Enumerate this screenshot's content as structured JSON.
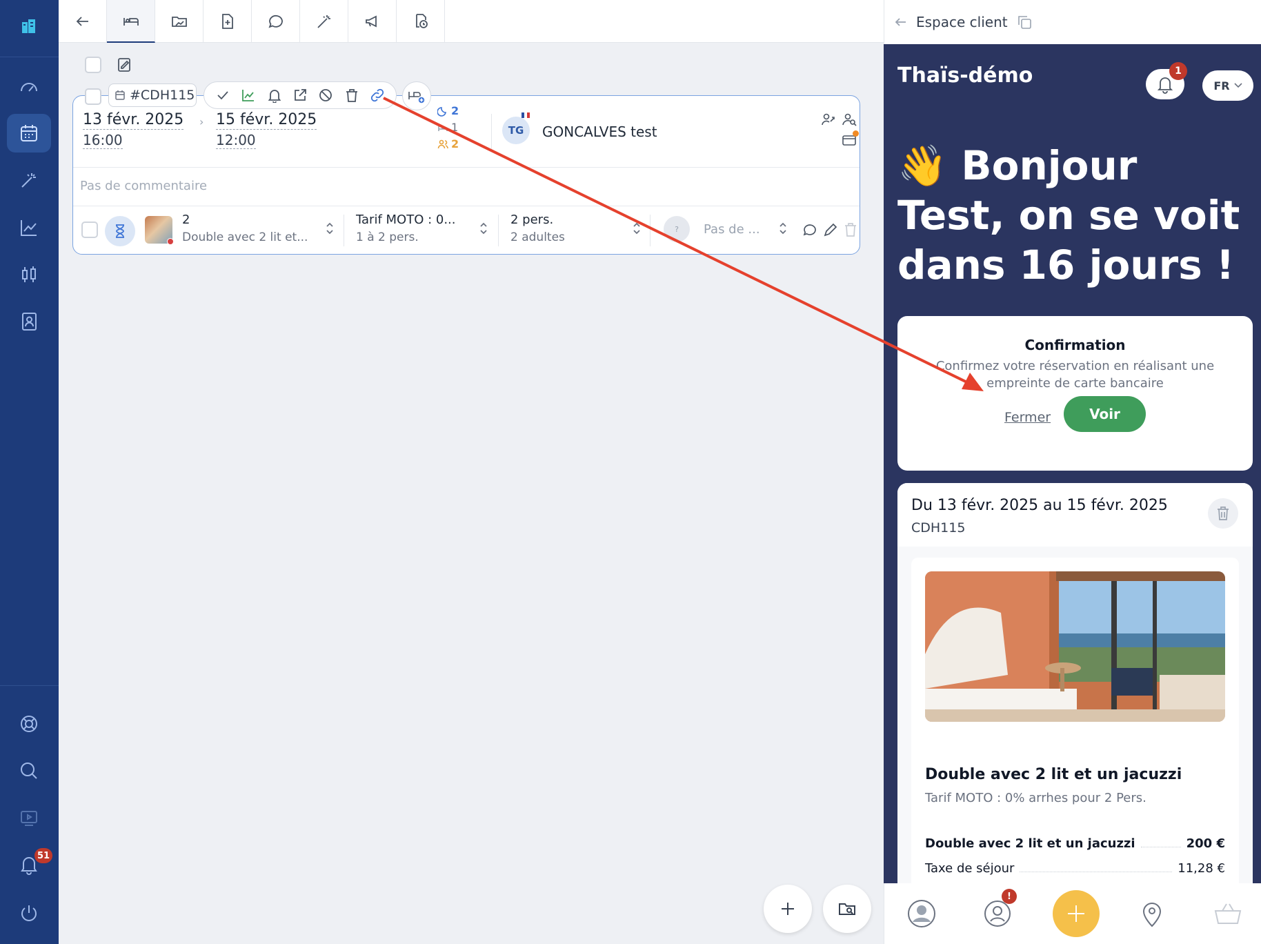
{
  "topbar": {
    "tabs": [
      "back",
      "bed",
      "folder",
      "document",
      "chat",
      "magic",
      "megaphone",
      "clock-doc"
    ]
  },
  "reservation": {
    "id": "#CDH115",
    "arrival_date": "13 févr. 2025",
    "arrival_time": "16:00",
    "departure_date": "15 févr. 2025",
    "departure_time": "12:00",
    "nights": "2",
    "rooms": "1",
    "guests": "2",
    "guest_initials": "TG",
    "guest_name": "GONCALVES test",
    "comment_placeholder": "Pas de commentaire",
    "room_qty": "2",
    "room_type": "Double avec 2 lit et...",
    "rate": "Tarif MOTO : 0...",
    "rate_sub": "1 à 2 pers.",
    "pax": "2 pers.",
    "pax_sub": "2 adultes",
    "unknown_avatar": "?",
    "unknown_label": "Pas de ..."
  },
  "sidebar": {
    "notif_count": "51"
  },
  "client_panel": {
    "header": "Espace client",
    "hotel_name": "Thaïs-démo",
    "notif_count": "1",
    "lang": "FR",
    "greeting_emoji": "👋",
    "greeting": "Bonjour Test, on se voit dans 16 jours !",
    "confirmation": {
      "title": "Confirmation",
      "text": "Confirmez votre réservation en réalisant une empreinte de carte bancaire",
      "close": "Fermer",
      "view": "Voir"
    },
    "booking": {
      "dates": "Du 13 févr. 2025 au 15 févr. 2025",
      "code": "CDH115",
      "room_name": "Double avec 2 lit et un jacuzzi",
      "rate": "Tarif MOTO : 0% arrhes pour 2 Pers.",
      "lines": [
        {
          "label": "Double avec 2 lit et un jacuzzi",
          "amount": "200 €"
        },
        {
          "label": "Taxe de séjour",
          "amount": "11,28 €"
        }
      ]
    },
    "bottom_nav_badge": "!"
  },
  "colors": {
    "sidebar": "#1d3b7a",
    "panel": "#2b3560",
    "accent_green": "#3f9d5b",
    "accent_yellow": "#f5c04a",
    "arrow": "#e5412d"
  }
}
